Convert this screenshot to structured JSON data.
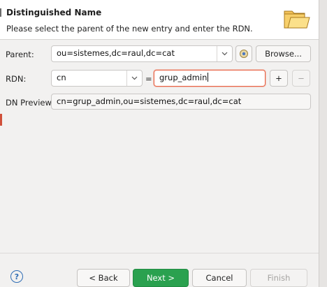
{
  "banner": {
    "title": "Distinguished Name",
    "description": "Please select the parent of the new entry and enter the RDN.",
    "icon": "folder-icon"
  },
  "form": {
    "parent_label": "Parent:",
    "parent_value": "ou=sistemes,dc=raul,dc=cat",
    "browse_label": "Browse...",
    "rdn_label": "RDN:",
    "rdn_attribute": "cn",
    "rdn_equals": "=",
    "rdn_value": "grup_admin",
    "add_label": "+",
    "remove_label": "−",
    "preview_label": "DN Preview:",
    "preview_value": "cn=grup_admin,ou=sistemes,dc=raul,dc=cat"
  },
  "footer": {
    "help_label": "?",
    "back_label": "< Back",
    "next_label": "Next >",
    "cancel_label": "Cancel",
    "finish_label": "Finish"
  },
  "colors": {
    "primary": "#2aa14f",
    "focus": "#e9674a",
    "help": "#2f6db5"
  }
}
